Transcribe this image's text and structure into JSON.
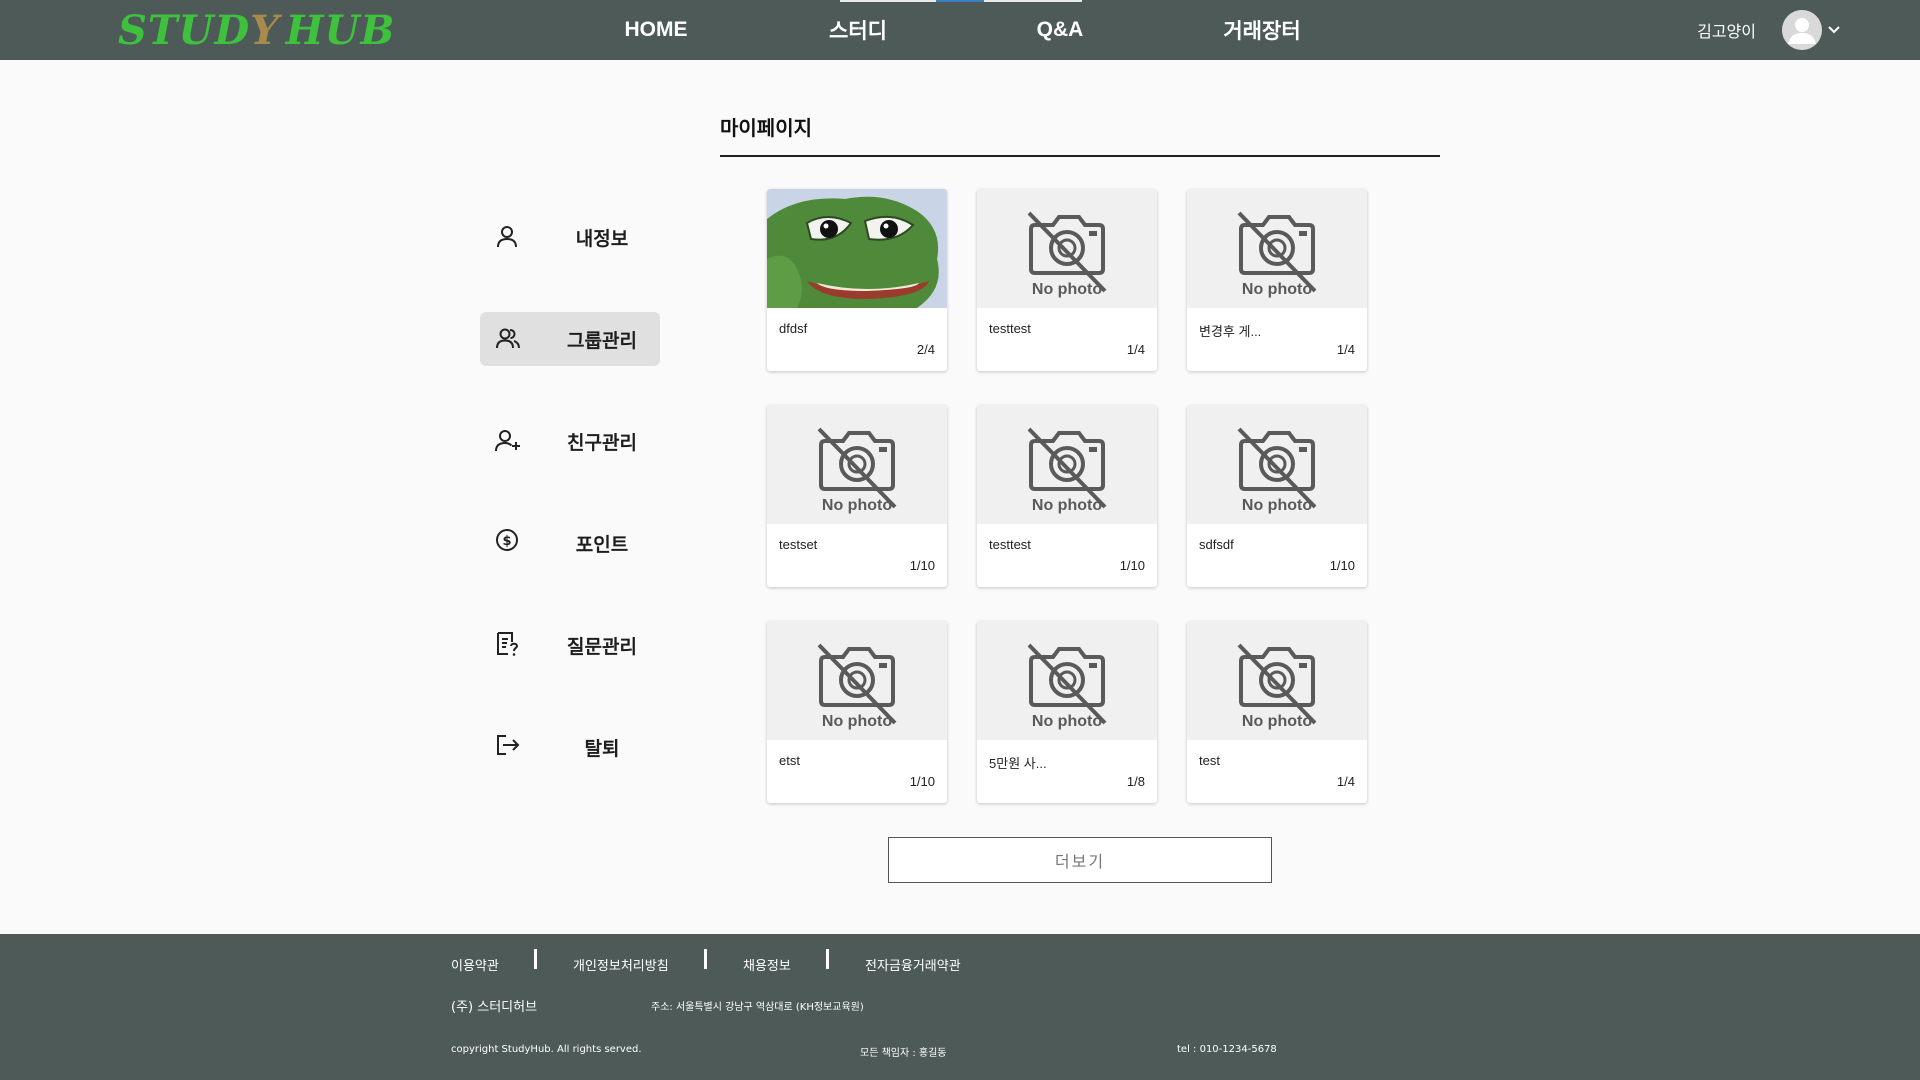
{
  "header": {
    "logo_left": "STUD",
    "logo_y": "Y",
    "logo_right": "HUB",
    "nav": {
      "home": "HOME",
      "study": "스터디",
      "qa": "Q&A",
      "market": "거래장터"
    },
    "username": "김고양이",
    "avatar_icon": "user-avatar-icon",
    "dropdown_icon": "chevron-down-icon"
  },
  "sidebar": {
    "items": [
      {
        "label": "내정보",
        "icon": "user-icon",
        "active": false
      },
      {
        "label": "그룹관리",
        "icon": "group-icon",
        "active": true
      },
      {
        "label": "친구관리",
        "icon": "add-friend-icon",
        "active": false
      },
      {
        "label": "포인트",
        "icon": "dollar-coin-icon",
        "active": false
      },
      {
        "label": "질문관리",
        "icon": "question-document-icon",
        "active": false
      },
      {
        "label": "탈퇴",
        "icon": "logout-icon",
        "active": false
      }
    ]
  },
  "main": {
    "title": "마이페이지",
    "no_photo_text": "No photo",
    "groups": [
      {
        "name": "dfdsf",
        "count": "2/4",
        "image": "frog-image"
      },
      {
        "name": "testtest",
        "count": "1/4",
        "image": "no-photo"
      },
      {
        "name": "변경후 게...",
        "count": "1/4",
        "image": "no-photo"
      },
      {
        "name": "testset",
        "count": "1/10",
        "image": "no-photo"
      },
      {
        "name": "testtest",
        "count": "1/10",
        "image": "no-photo"
      },
      {
        "name": "sdfsdf",
        "count": "1/10",
        "image": "no-photo"
      },
      {
        "name": "etst",
        "count": "1/10",
        "image": "no-photo"
      },
      {
        "name": "5만원 사...",
        "count": "1/8",
        "image": "no-photo"
      },
      {
        "name": "test",
        "count": "1/4",
        "image": "no-photo"
      }
    ],
    "more_button": "더보기"
  },
  "footer": {
    "links": [
      "이용약관",
      "개인정보처리방침",
      "채용정보",
      "전자금융거래약관"
    ],
    "company": "(주) 스터디허브",
    "address": "주소: 서울특별시 강남구 역삼대로 (KH정보교육원)",
    "copyright": "copyright StudyHub. All rights served.",
    "owner": "모든 책임자 : 홍길동",
    "tel": "tel : 010-1234-5678"
  },
  "colors": {
    "header_bg": "#4d5a58",
    "footer_bg": "#4d5a58",
    "logo_green": "#3ec23e",
    "logo_brown": "#a88a4a",
    "active_item_bg": "#e0e0e0",
    "nav_indicator": "#3c7dc0"
  }
}
